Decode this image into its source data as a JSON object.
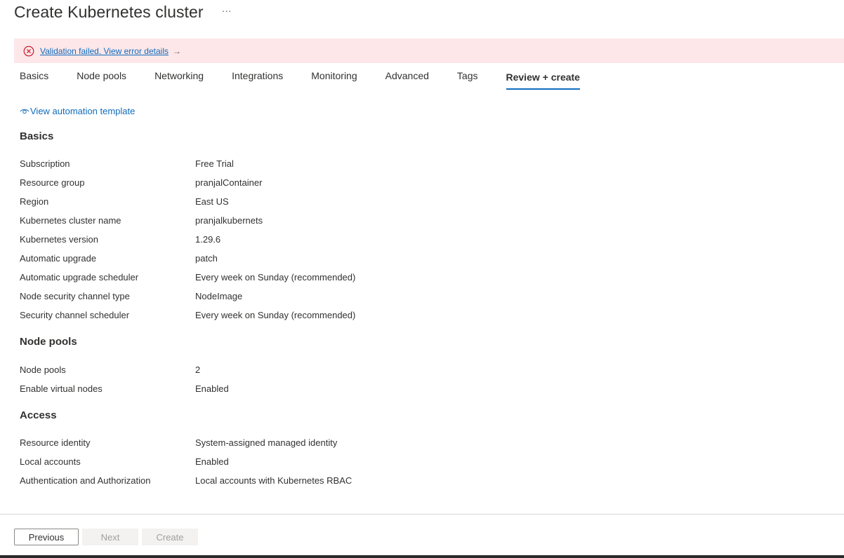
{
  "header": {
    "title": "Create Kubernetes cluster",
    "more_label": "···"
  },
  "error_banner": {
    "text": "Validation failed. View error details",
    "arrow": "→",
    "icon": "error-circle-icon",
    "background_color": "#fde7e9",
    "icon_color": "#c50f1f"
  },
  "tabs": [
    {
      "label": "Basics"
    },
    {
      "label": "Node pools"
    },
    {
      "label": "Networking"
    },
    {
      "label": "Integrations"
    },
    {
      "label": "Monitoring"
    },
    {
      "label": "Advanced"
    },
    {
      "label": "Tags"
    },
    {
      "label": "Review + create",
      "active": true
    }
  ],
  "automation_link": {
    "label": "View automation template",
    "icon": "eye-icon"
  },
  "sections": {
    "basics": {
      "heading": "Basics",
      "rows": [
        {
          "label": "Subscription",
          "value": "Free Trial"
        },
        {
          "label": "Resource group",
          "value": "pranjalContainer"
        },
        {
          "label": "Region",
          "value": "East US"
        },
        {
          "label": "Kubernetes cluster name",
          "value": "pranjalkubernets"
        },
        {
          "label": "Kubernetes version",
          "value": "1.29.6"
        },
        {
          "label": "Automatic upgrade",
          "value": "patch"
        },
        {
          "label": "Automatic upgrade scheduler",
          "value": "Every week on Sunday (recommended)"
        },
        {
          "label": "Node security channel type",
          "value": "NodeImage"
        },
        {
          "label": "Security channel scheduler",
          "value": "Every week on Sunday (recommended)"
        }
      ]
    },
    "node_pools": {
      "heading": "Node pools",
      "rows": [
        {
          "label": "Node pools",
          "value": "2"
        },
        {
          "label": "Enable virtual nodes",
          "value": "Enabled"
        }
      ]
    },
    "access": {
      "heading": "Access",
      "rows": [
        {
          "label": "Resource identity",
          "value": "System-assigned managed identity"
        },
        {
          "label": "Local accounts",
          "value": "Enabled"
        },
        {
          "label": "Authentication and Authorization",
          "value": "Local accounts with Kubernetes RBAC"
        }
      ]
    }
  },
  "footer": {
    "previous_label": "Previous",
    "next_label": "Next",
    "create_label": "Create"
  },
  "colors": {
    "accent": "#0f6cbd",
    "text": "#323130"
  }
}
